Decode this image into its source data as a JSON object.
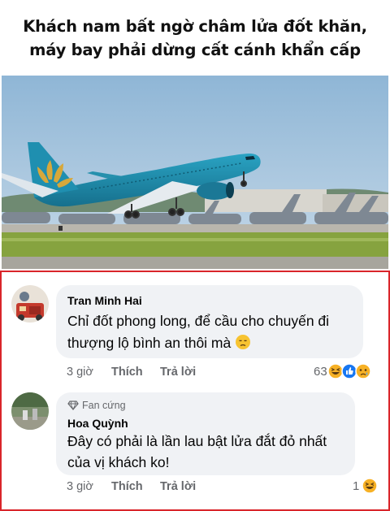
{
  "headline": {
    "line1": "Khách nam bất ngờ châm lửa đốt khăn,",
    "line2": "máy bay phải dừng cất cánh khẩn cấp"
  },
  "colors": {
    "comment_border": "#d9252a",
    "bubble_bg": "#f0f2f5",
    "meta_text": "#65676b",
    "like_blue": "#1877f2",
    "haha_yellow": "#f7b125",
    "aircraft_livery": "#1f8fb0"
  },
  "comments": [
    {
      "author": "Tran Minh Hai",
      "text_line1": "Chỉ đốt phong long, để cầu cho chuyến đi",
      "text_line2": "thượng lộ bình an thôi mà",
      "inline_emoji": "sad-face-icon",
      "time": "3 giờ",
      "like_label": "Thích",
      "reply_label": "Trả lời",
      "reaction_count": "63",
      "reaction_icons": [
        "haha-icon",
        "like-icon",
        "sad-icon"
      ]
    },
    {
      "badge": "Fan cứng",
      "badge_icon": "diamond-icon",
      "author": "Hoa Quỳnh",
      "text_line1": "Đây có phải là lần lau bật lửa đắt đỏ nhất",
      "text_line2": "của vị khách ko!",
      "time": "3 giờ",
      "like_label": "Thích",
      "reply_label": "Trả lời",
      "reaction_count": "1",
      "reaction_icons": [
        "haha-icon"
      ]
    }
  ]
}
